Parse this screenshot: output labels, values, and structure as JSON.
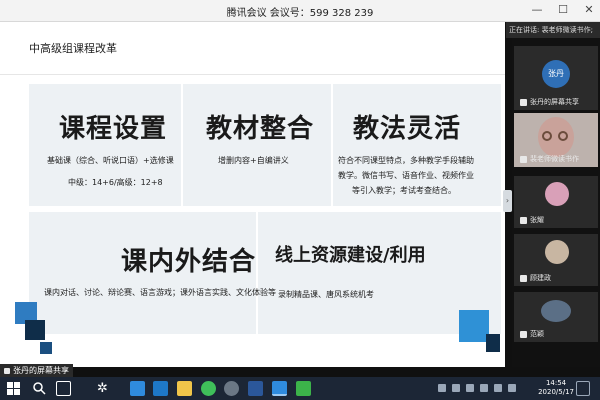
{
  "window": {
    "title": "腾讯会议 会议号：599 328 239",
    "controls": [
      "—",
      "☐",
      "✕"
    ]
  },
  "slide": {
    "title": "中高级组课程改革",
    "cells": [
      {
        "heading": "课程设置",
        "lines": [
          "基础课（综合、听说口语）+选修课",
          "中级：14+6/高级：12+8"
        ]
      },
      {
        "heading": "教材整合",
        "lines": [
          "增删内容+自编讲义"
        ]
      },
      {
        "heading": "教法灵活",
        "lines": [
          "符合不同课型特点，多种教学手段辅助",
          "教学。微信书写、语音作业、视频作业",
          "等引入教学；考试考查结合。"
        ]
      },
      {
        "heading": "课内外结合",
        "lines": [
          "课内对话、讨论、辩论赛、语言游戏；课外语言实践、文化体验等"
        ]
      },
      {
        "heading": "线上资源建设/利用",
        "lines": [
          "录制精品课、唐风系统机考"
        ]
      }
    ]
  },
  "sidebar": {
    "speaking_tooltip": "正在讲话: 裴老师微读书作;",
    "participants": [
      {
        "name": "张丹的屏幕共享",
        "avatar_text": "张丹",
        "avatar_color": "#2f6fb6"
      },
      {
        "name": "裴老师微读书作",
        "avatar_text": "",
        "avatar_color": "#c9a29a"
      },
      {
        "name": "张耀",
        "avatar_text": "",
        "avatar_color": "#d9a0b8"
      },
      {
        "name": "顾建政",
        "avatar_text": "",
        "avatar_color": "#c8b6a2"
      },
      {
        "name": "范颖",
        "avatar_text": "",
        "avatar_color": "#5b6f86"
      }
    ],
    "collapse_glyph": "›"
  },
  "share_label": "张丹的屏幕共享",
  "taskbar": {
    "time": "14:54",
    "date": "2020/5/17",
    "icons": [
      "windows-start-icon",
      "search-icon",
      "task-view-icon",
      "settings-icon",
      "mail-icon",
      "file-explorer-icon",
      "folder-icon",
      "browser-icon",
      "app-icon",
      "word-icon",
      "tencent-meeting-icon",
      "wechat-icon"
    ],
    "colors": {
      "bar": "#1c2636",
      "start": "#ffffff",
      "accent": "#2f8bde"
    }
  }
}
